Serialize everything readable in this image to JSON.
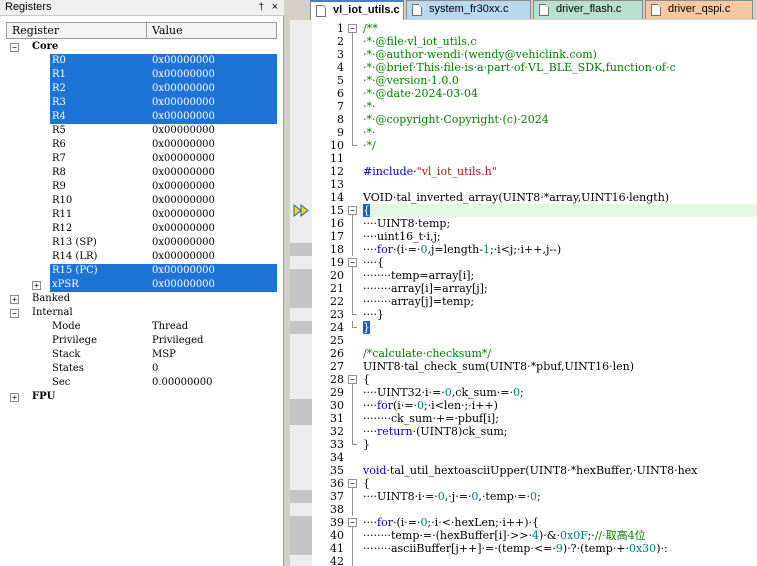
{
  "registers": {
    "pane_title": "Registers",
    "pin_glyph": "†",
    "close_glyph": "×",
    "col_register": "Register",
    "col_value": "Value",
    "rows": [
      {
        "kind": "group",
        "toggle": "−",
        "name": "Core",
        "value": ""
      },
      {
        "kind": "reg",
        "name": "R0",
        "value": "0x00000000",
        "selected": true
      },
      {
        "kind": "reg",
        "name": "R1",
        "value": "0x00000000",
        "selected": true
      },
      {
        "kind": "reg",
        "name": "R2",
        "value": "0x00000000",
        "selected": true
      },
      {
        "kind": "reg",
        "name": "R3",
        "value": "0x00000000",
        "selected": true
      },
      {
        "kind": "reg",
        "name": "R4",
        "value": "0x00000000",
        "selected": true
      },
      {
        "kind": "reg",
        "name": "R5",
        "value": "0x00000000",
        "selected": false
      },
      {
        "kind": "reg",
        "name": "R6",
        "value": "0x00000000",
        "selected": false
      },
      {
        "kind": "reg",
        "name": "R7",
        "value": "0x00000000",
        "selected": false
      },
      {
        "kind": "reg",
        "name": "R8",
        "value": "0x00000000",
        "selected": false
      },
      {
        "kind": "reg",
        "name": "R9",
        "value": "0x00000000",
        "selected": false
      },
      {
        "kind": "reg",
        "name": "R10",
        "value": "0x00000000",
        "selected": false
      },
      {
        "kind": "reg",
        "name": "R11",
        "value": "0x00000000",
        "selected": false
      },
      {
        "kind": "reg",
        "name": "R12",
        "value": "0x00000000",
        "selected": false
      },
      {
        "kind": "reg",
        "name": "R13 (SP)",
        "value": "0x00000000",
        "selected": false
      },
      {
        "kind": "reg",
        "name": "R14 (LR)",
        "value": "0x00000000",
        "selected": false
      },
      {
        "kind": "reg",
        "name": "R15 (PC)",
        "value": "0x00000000",
        "selected": true
      },
      {
        "kind": "regx",
        "toggle": "+",
        "name": "xPSR",
        "value": "0x00000000",
        "selected": true
      },
      {
        "kind": "sub",
        "toggle": "+",
        "name": "Banked",
        "value": ""
      },
      {
        "kind": "sub",
        "toggle": "−",
        "name": "Internal",
        "value": ""
      },
      {
        "kind": "reg",
        "name": "Mode",
        "value": "Thread",
        "selected": false
      },
      {
        "kind": "reg",
        "name": "Privilege",
        "value": "Privileged",
        "selected": false
      },
      {
        "kind": "reg",
        "name": "Stack",
        "value": "MSP",
        "selected": false
      },
      {
        "kind": "reg",
        "name": "States",
        "value": "0",
        "selected": false
      },
      {
        "kind": "reg",
        "name": "Sec",
        "value": "0.00000000",
        "selected": false
      },
      {
        "kind": "group",
        "toggle": "+",
        "name": "FPU",
        "value": ""
      }
    ]
  },
  "tabs": [
    {
      "label": "vl_iot_utils.c",
      "active": true,
      "color": "#ffffff",
      "icon_color": "#ffffff"
    },
    {
      "label": "system_fr30xx.c",
      "active": false,
      "color": "#b8d8f0",
      "icon_color": "#ffffff"
    },
    {
      "label": "driver_flash.c",
      "active": false,
      "color": "#b8e0d0",
      "icon_color": "#ffffff"
    },
    {
      "label": "driver_qspi.c",
      "active": false,
      "color": "#f8c8a0",
      "icon_color": "#ffffff"
    }
  ],
  "editor": {
    "current_line": 15,
    "arrow_colors": [
      "#ffd800",
      "#1060e0"
    ],
    "lines": [
      {
        "n": "1",
        "fold": "box-",
        "mk": "",
        "segs": [
          [
            "cm",
            "/**"
          ]
        ]
      },
      {
        "n": "2",
        "fold": "v",
        "mk": "",
        "segs": [
          [
            "cm",
            "·*·@file·vl_iot_utils.c"
          ]
        ]
      },
      {
        "n": "3",
        "fold": "v",
        "mk": "",
        "segs": [
          [
            "cm",
            "·*·@author·wendi·(wendy@vehiclink.com)"
          ]
        ]
      },
      {
        "n": "4",
        "fold": "v",
        "mk": "",
        "segs": [
          [
            "cm",
            "·*·@brief·This·file·is·a·part·of·VL_BLE_SDK,function·of·c"
          ]
        ]
      },
      {
        "n": "5",
        "fold": "v",
        "mk": "",
        "segs": [
          [
            "cm",
            "·*·@version·1.0.0"
          ]
        ]
      },
      {
        "n": "6",
        "fold": "v",
        "mk": "",
        "segs": [
          [
            "cm",
            "·*·@date·2024-03-04"
          ]
        ]
      },
      {
        "n": "7",
        "fold": "v",
        "mk": "",
        "segs": [
          [
            "cm",
            "·*·"
          ]
        ]
      },
      {
        "n": "8",
        "fold": "v",
        "mk": "",
        "segs": [
          [
            "cm",
            "·*·@copyright·Copyright·(c)·2024"
          ]
        ]
      },
      {
        "n": "9",
        "fold": "v",
        "mk": "",
        "segs": [
          [
            "cm",
            "·*·"
          ]
        ]
      },
      {
        "n": "10",
        "fold": "end",
        "mk": "",
        "segs": [
          [
            "cm",
            "·*/"
          ]
        ]
      },
      {
        "n": "11",
        "fold": "",
        "mk": "",
        "segs": []
      },
      {
        "n": "12",
        "fold": "",
        "mk": "",
        "segs": [
          [
            "pp",
            "#include"
          ],
          [
            "",
            "·"
          ],
          [
            "st",
            "\"vl_iot_utils.h\""
          ]
        ]
      },
      {
        "n": "13",
        "fold": "",
        "mk": "",
        "segs": []
      },
      {
        "n": "14",
        "fold": "",
        "mk": "",
        "segs": [
          [
            "",
            "VOID·tal_inverted_array(UINT8·*array,UINT16·length)"
          ]
        ]
      },
      {
        "n": "15",
        "fold": "box-",
        "mk": "",
        "segs": [
          [
            "bk",
            "{"
          ]
        ]
      },
      {
        "n": "16",
        "fold": "v",
        "mk": "",
        "segs": [
          [
            "",
            "····UINT8·temp;"
          ]
        ]
      },
      {
        "n": "17",
        "fold": "v",
        "mk": "",
        "segs": [
          [
            "",
            "····uint16_t·i,j;"
          ]
        ]
      },
      {
        "n": "18",
        "fold": "v",
        "mk": "grey",
        "segs": [
          [
            "",
            "····"
          ],
          [
            "kw",
            "for"
          ],
          [
            "",
            "·(i·=·"
          ],
          [
            "nm",
            "0"
          ],
          [
            "",
            ",j=length-"
          ],
          [
            "nm",
            "1"
          ],
          [
            "",
            ";·i<j;·i++,j--)"
          ]
        ]
      },
      {
        "n": "19",
        "fold": "box-",
        "mk": "",
        "segs": [
          [
            "",
            "····{"
          ]
        ]
      },
      {
        "n": "20",
        "fold": "v",
        "mk": "grey",
        "segs": [
          [
            "",
            "········temp=array[i];"
          ]
        ]
      },
      {
        "n": "21",
        "fold": "v",
        "mk": "grey",
        "segs": [
          [
            "",
            "········array[i]=array[j];"
          ]
        ]
      },
      {
        "n": "22",
        "fold": "v",
        "mk": "grey",
        "segs": [
          [
            "",
            "········array[j]=temp;"
          ]
        ]
      },
      {
        "n": "23",
        "fold": "end",
        "mk": "",
        "segs": [
          [
            "",
            "····}"
          ]
        ]
      },
      {
        "n": "24",
        "fold": "end",
        "mk": "grey",
        "segs": [
          [
            "bk",
            "}"
          ]
        ]
      },
      {
        "n": "25",
        "fold": "",
        "mk": "",
        "segs": []
      },
      {
        "n": "26",
        "fold": "",
        "mk": "",
        "segs": [
          [
            "cm",
            "/*calculate·checksum*/"
          ]
        ]
      },
      {
        "n": "27",
        "fold": "",
        "mk": "",
        "segs": [
          [
            "",
            "UINT8·tal_check_sum(UINT8·*pbuf,UINT16·len)"
          ]
        ]
      },
      {
        "n": "28",
        "fold": "box-",
        "mk": "",
        "segs": [
          [
            "",
            "{"
          ]
        ]
      },
      {
        "n": "29",
        "fold": "v",
        "mk": "",
        "segs": [
          [
            "",
            "····UINT32·i·=·"
          ],
          [
            "nm",
            "0"
          ],
          [
            "",
            ",ck_sum·=·"
          ],
          [
            "nm",
            "0"
          ],
          [
            "",
            ";"
          ]
        ]
      },
      {
        "n": "30",
        "fold": "v",
        "mk": "grey",
        "segs": [
          [
            "",
            "····"
          ],
          [
            "kw",
            "for"
          ],
          [
            "",
            "(i·=·"
          ],
          [
            "nm",
            "0"
          ],
          [
            "",
            ";·i<len·;·i++)"
          ]
        ]
      },
      {
        "n": "31",
        "fold": "v",
        "mk": "grey",
        "segs": [
          [
            "",
            "········ck_sum·+=·pbuf[i];"
          ]
        ]
      },
      {
        "n": "32",
        "fold": "v",
        "mk": "",
        "segs": [
          [
            "",
            "····"
          ],
          [
            "kw",
            "return"
          ],
          [
            "",
            "·(UINT8)ck_sum;"
          ]
        ]
      },
      {
        "n": "33",
        "fold": "end",
        "mk": "",
        "segs": [
          [
            "",
            "}"
          ]
        ]
      },
      {
        "n": "34",
        "fold": "",
        "mk": "",
        "segs": []
      },
      {
        "n": "35",
        "fold": "",
        "mk": "",
        "segs": [
          [
            "kw",
            "void"
          ],
          [
            "",
            "·tal_util_hextoasciiUpper(UINT8·*hexBuffer,·UINT8·hex"
          ]
        ]
      },
      {
        "n": "36",
        "fold": "box-",
        "mk": "",
        "segs": [
          [
            "",
            "{"
          ]
        ]
      },
      {
        "n": "37",
        "fold": "v",
        "mk": "grey",
        "segs": [
          [
            "",
            "····UINT8·i·=·"
          ],
          [
            "nm",
            "0"
          ],
          [
            "",
            ",·j·=·"
          ],
          [
            "nm",
            "0"
          ],
          [
            "",
            ",·temp·=·"
          ],
          [
            "nm",
            "0"
          ],
          [
            "",
            ";"
          ]
        ]
      },
      {
        "n": "38",
        "fold": "v",
        "mk": "",
        "segs": []
      },
      {
        "n": "39",
        "fold": "box-",
        "mk": "grey",
        "segs": [
          [
            "",
            "····"
          ],
          [
            "kw",
            "for"
          ],
          [
            "",
            "·(i·=·"
          ],
          [
            "nm",
            "0"
          ],
          [
            "",
            ";·i·<·hexLen;·i++)·{"
          ]
        ]
      },
      {
        "n": "40",
        "fold": "v",
        "mk": "grey",
        "segs": [
          [
            "",
            "········temp·=·(hexBuffer[i]·>>·"
          ],
          [
            "nm",
            "4"
          ],
          [
            "",
            ")·&·"
          ],
          [
            "nm",
            "0x0F"
          ],
          [
            "",
            ";·"
          ],
          [
            "cm",
            "//·取高4位"
          ]
        ]
      },
      {
        "n": "41",
        "fold": "v",
        "mk": "grey",
        "segs": [
          [
            "",
            "········asciiBuffer[j++]·=·(temp·<=·"
          ],
          [
            "nm",
            "9"
          ],
          [
            "",
            ")·?·(temp·+·"
          ],
          [
            "nm",
            "0x30"
          ],
          [
            "",
            ")·:"
          ]
        ]
      },
      {
        "n": "42",
        "fold": "v",
        "mk": "",
        "segs": []
      }
    ]
  }
}
